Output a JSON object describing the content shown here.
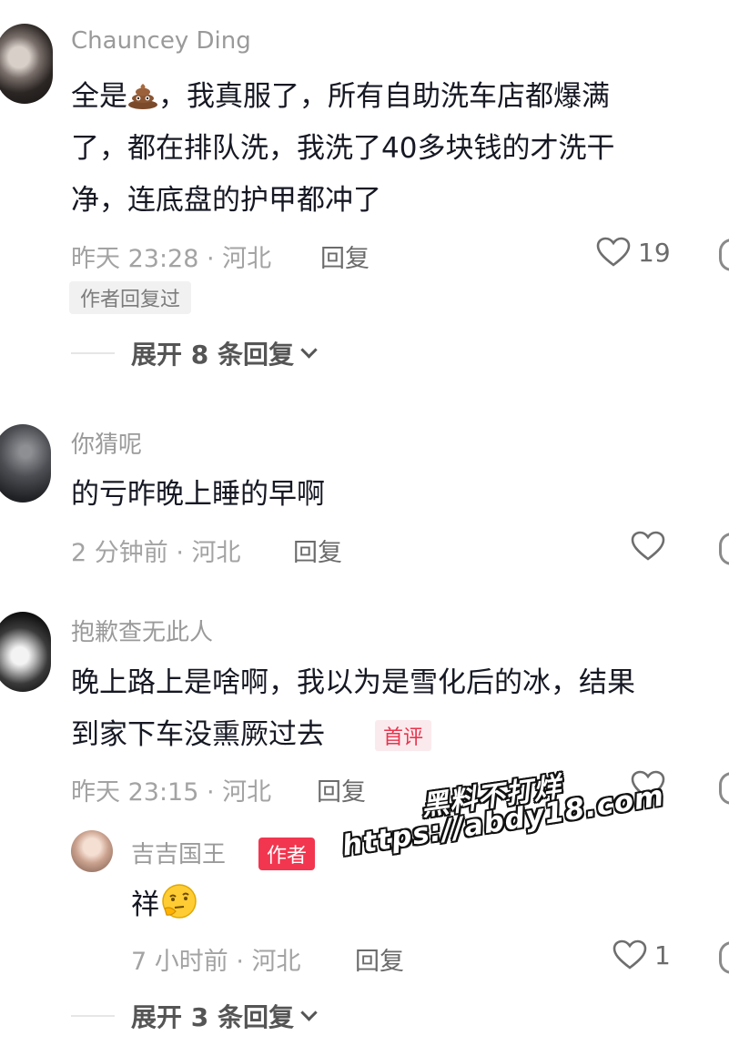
{
  "comments": [
    {
      "username": "Chauncey Ding",
      "text_before_emoji": "全是",
      "emoji": "poop-emoji",
      "text_line1_rest": "，我真服了，所有自助洗车店都爆满",
      "text_line2": "了，都在排队洗，我洗了40多块钱的才洗干",
      "text_line3": "净，连底盘的护甲都冲了",
      "meta": "昨天 23:28 · 河北",
      "reply_label": "回复",
      "likes": "19",
      "author_replied_tag": "作者回复过",
      "expand_label": "展开 8 条回复"
    },
    {
      "username": "你猜呢",
      "text": "的亏昨晚上睡的早啊",
      "meta": "2 分钟前 · 河北",
      "reply_label": "回复"
    },
    {
      "username": "抱歉查无此人",
      "text_line1": "晚上路上是啥啊，我以为是雪化后的冰，结果",
      "text_line2": "到家下车没熏厥过去",
      "first_comment_badge": "首评",
      "meta": "昨天 23:15 · 河北",
      "reply_label": "回复",
      "reply": {
        "username": "吉吉国王",
        "author_badge": "作者",
        "text": "祥",
        "emoji": "thinking-face-emoji",
        "meta": "7 小时前 · 河北",
        "reply_label": "回复",
        "likes": "1"
      },
      "expand_label": "展开 3 条回复"
    }
  ],
  "watermark": {
    "line1": "黑料不打烊",
    "line2": "https://abdy18.com"
  },
  "colors": {
    "accent_red": "#f2364f",
    "meta_gray": "#a3a3a3",
    "text_dark": "#161823"
  }
}
